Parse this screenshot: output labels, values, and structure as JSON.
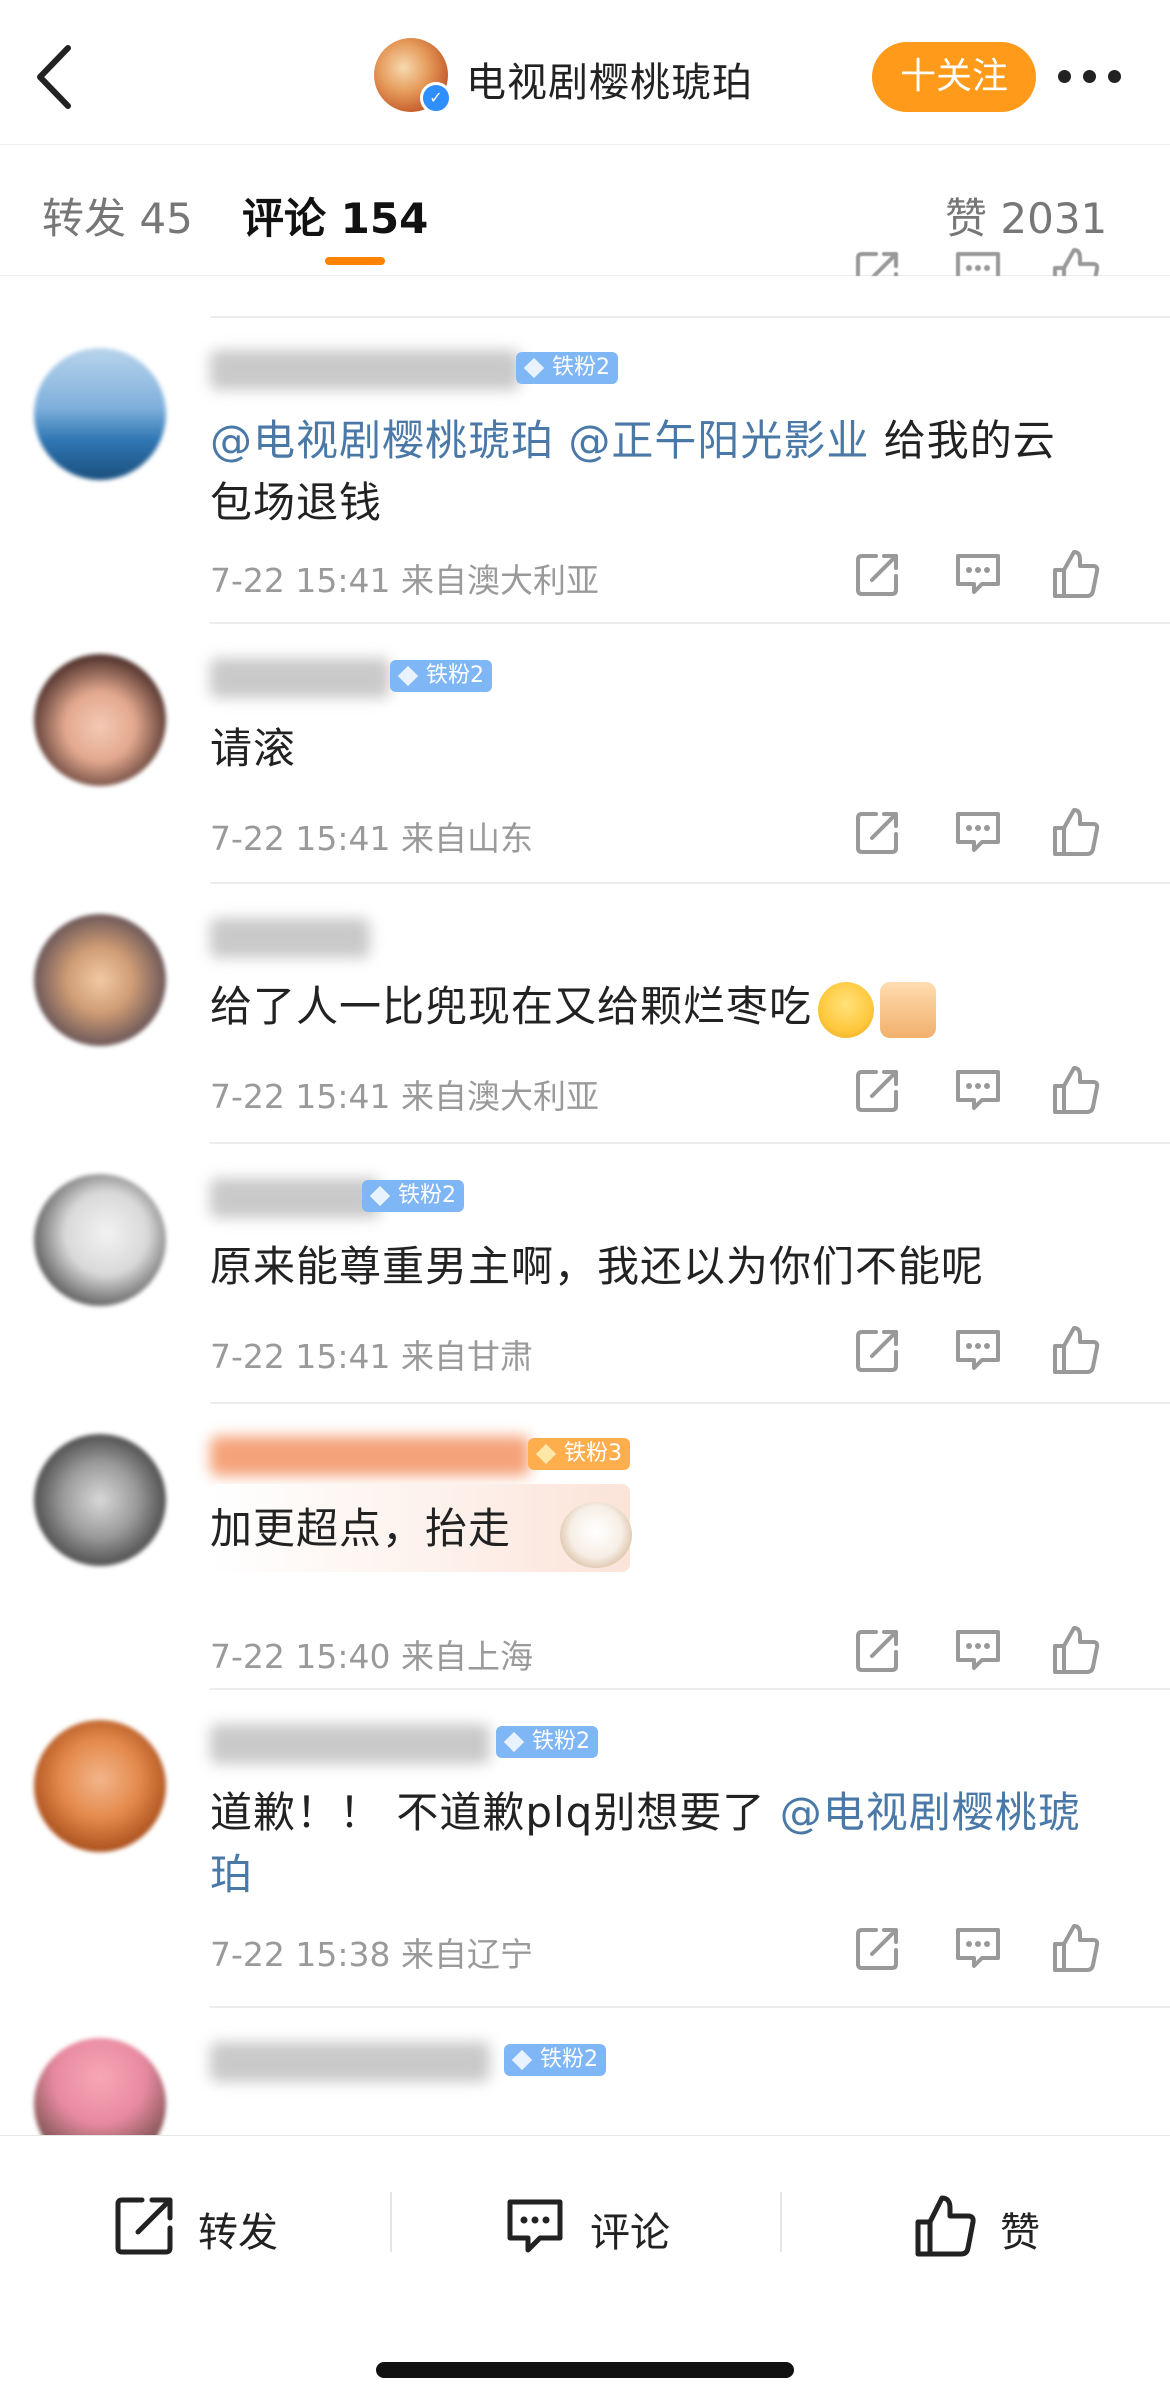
{
  "header": {
    "account_name": "电视剧樱桃琥珀",
    "follow_label": "十关注"
  },
  "tabs": {
    "repost_label": "转发",
    "repost_count": "45",
    "comment_label": "评论",
    "comment_count": "154",
    "like_label": "赞",
    "like_count": "2031"
  },
  "comments": [
    {
      "badge": "铁粉2",
      "mention1": "@电视剧樱桃琥珀",
      "mention2": "@正午阳光影业",
      "text_a": " 给我的云",
      "text_b": "包场退钱",
      "time": "7-22 15:41",
      "location": "来自澳大利亚"
    },
    {
      "badge": "铁粉2",
      "text": "请滚",
      "time": "7-22 15:41",
      "location": "来自山东"
    },
    {
      "text": "给了人一比兜现在又给颗烂枣吃",
      "time": "7-22 15:41",
      "location": "来自澳大利亚"
    },
    {
      "badge": "铁粉2",
      "text": "原来能尊重男主啊，我还以为你们不能呢",
      "time": "7-22 15:41",
      "location": "来自甘肃"
    },
    {
      "badge": "铁粉3",
      "text": "加更超点，抬走",
      "time": "7-22 15:40",
      "location": "来自上海"
    },
    {
      "badge": "铁粉2",
      "text": "道歉！！ 不道歉plq别想要了",
      "mention": "@电视剧樱桃琥",
      "text_b": "珀",
      "time": "7-22 15:38",
      "location": "来自辽宁"
    },
    {
      "badge": "铁粉2"
    }
  ],
  "bottom_bar": {
    "repost_label": "转发",
    "comment_label": "评论",
    "like_label": "赞"
  },
  "colors": {
    "accent_orange": "#ff8200",
    "follow_button": "#ff9a1a",
    "mention_blue": "#4a79a8",
    "badge_blue": "#7fb6f5",
    "meta_gray": "#9a9a9a"
  }
}
